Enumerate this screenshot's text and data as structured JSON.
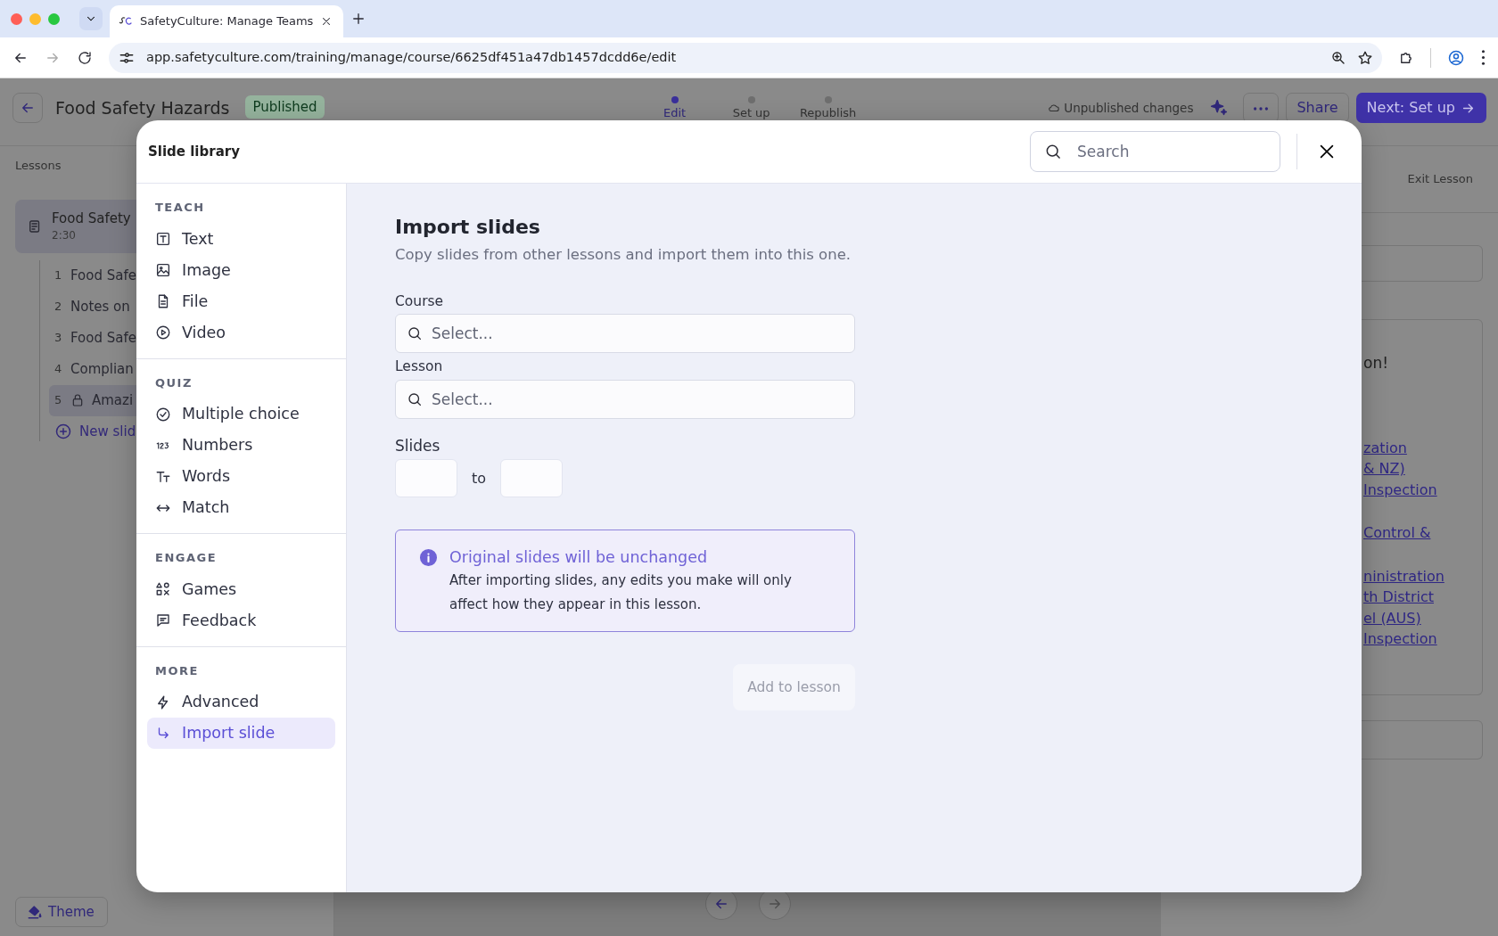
{
  "browser": {
    "tabs": [
      {
        "title": "SafetyCulture: Manage Teams",
        "selected": true
      }
    ],
    "url": "app.safetyculture.com/training/manage/course/6625df451a47db1457dcdd6e/edit"
  },
  "header": {
    "title": "Food Safety Hazards",
    "status": "Published",
    "steps": [
      {
        "label": "Edit",
        "selected": true
      },
      {
        "label": "Set up",
        "selected": false
      },
      {
        "label": "Republish",
        "selected": false
      }
    ],
    "save_state": "Unpublished changes",
    "share": "Share",
    "next": "Next: Set up"
  },
  "sidebar": {
    "heading": "Lessons",
    "lesson": {
      "title": "Food Safety",
      "duration": "2:30"
    },
    "slides": [
      {
        "number": "1",
        "title": "Food Safe",
        "locked": false,
        "selected": false
      },
      {
        "number": "2",
        "title": "Notes on",
        "locked": false,
        "selected": false
      },
      {
        "number": "3",
        "title": "Food Safe",
        "locked": false,
        "selected": false
      },
      {
        "number": "4",
        "title": "Complian",
        "locked": false,
        "selected": false
      },
      {
        "number": "5",
        "title": "Amazi",
        "locked": true,
        "selected": true
      }
    ],
    "new_slide": "New slid",
    "theme": "Theme"
  },
  "preview": {
    "exit": "Exit Lesson",
    "heading": "on!",
    "link_groups": [
      [
        "zation",
        "& NZ)",
        "Inspection"
      ],
      [
        "Control &"
      ],
      [
        "ninistration",
        "th District",
        "el (AUS)",
        "Inspection"
      ]
    ]
  },
  "modal": {
    "title": "Slide library",
    "search_placeholder": "Search",
    "sections": [
      {
        "heading": "TEACH",
        "items": [
          {
            "label": "Text",
            "kind": "text",
            "selected": false
          },
          {
            "label": "Image",
            "kind": "image",
            "selected": false
          },
          {
            "label": "File",
            "kind": "file",
            "selected": false
          },
          {
            "label": "Video",
            "kind": "video",
            "selected": false
          }
        ]
      },
      {
        "heading": "QUIZ",
        "items": [
          {
            "label": "Multiple choice",
            "kind": "check",
            "selected": false
          },
          {
            "label": "Numbers",
            "kind": "numbers",
            "selected": false
          },
          {
            "label": "Words",
            "kind": "words",
            "selected": false
          },
          {
            "label": "Match",
            "kind": "match",
            "selected": false
          }
        ]
      },
      {
        "heading": "ENGAGE",
        "items": [
          {
            "label": "Games",
            "kind": "games",
            "selected": false
          },
          {
            "label": "Feedback",
            "kind": "feedback",
            "selected": false
          }
        ]
      },
      {
        "heading": "MORE",
        "items": [
          {
            "label": "Advanced",
            "kind": "bolt",
            "selected": false
          },
          {
            "label": "Import slide",
            "kind": "import",
            "selected": true
          }
        ]
      }
    ],
    "import": {
      "title": "Import slides",
      "subtitle": "Copy slides from other lessons and import them into this one.",
      "fields": [
        {
          "label": "Course",
          "placeholder": "Select..."
        },
        {
          "label": "Lesson",
          "placeholder": "Select..."
        }
      ],
      "slides_label": "Slides",
      "range_separator": "to",
      "info": {
        "title": "Original slides will be unchanged",
        "text": "After importing slides, any edits you make will only affect how they appear in this lesson."
      },
      "button": {
        "label": "Add to lesson",
        "disabled": true
      }
    }
  }
}
